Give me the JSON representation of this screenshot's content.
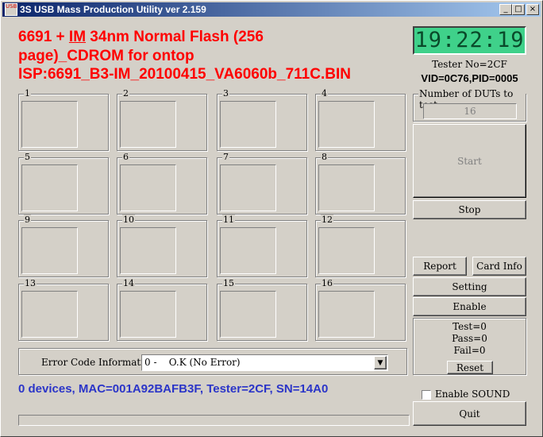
{
  "window": {
    "title": "3S USB Mass Production Utility ver 2.159",
    "icon_text": "USB",
    "minimize_glyph": "_",
    "maximize_glyph": "□",
    "close_glyph": "×"
  },
  "headline": {
    "line1_a": "6691 + ",
    "line1_b": "IM",
    "line1_c": " 34nm Normal Flash (256",
    "line2": "page)_CDROM for ontop",
    "line3": "ISP:6691_B3-IM_20100415_VA6060b_711C.BIN"
  },
  "clock": {
    "time": "19:22:19"
  },
  "tester": {
    "tester_no": "Tester No=2CF",
    "vid_pid": "VID=0C76,PID=0005"
  },
  "duts": {
    "label": "Number of DUTs to test",
    "value": "16"
  },
  "slots": [
    "1",
    "2",
    "3",
    "4",
    "5",
    "6",
    "7",
    "8",
    "9",
    "10",
    "11",
    "12",
    "13",
    "14",
    "15",
    "16"
  ],
  "buttons": {
    "start": "Start",
    "stop": "Stop",
    "report": "Report",
    "card_info": "Card Info",
    "setting": "Setting",
    "enable": "Enable",
    "reset": "Reset",
    "quit": "Quit"
  },
  "counters": {
    "test": "Test=0",
    "pass": "Pass=0",
    "fail": "Fail=0"
  },
  "error_code": {
    "label": "Error Code Information:",
    "selected": "0 -    O.K (No Error)",
    "dropdown_glyph": "▼"
  },
  "status_line": "0 devices, MAC=001A92BAFB3F, Tester=2CF, SN=14A0",
  "enable_sound": {
    "label": "Enable SOUND",
    "checked": false
  },
  "colors": {
    "headline": "#ff0000",
    "status": "#2b35c8",
    "clock_bg": "#3fd18a",
    "title_bar": "#0a246a"
  }
}
